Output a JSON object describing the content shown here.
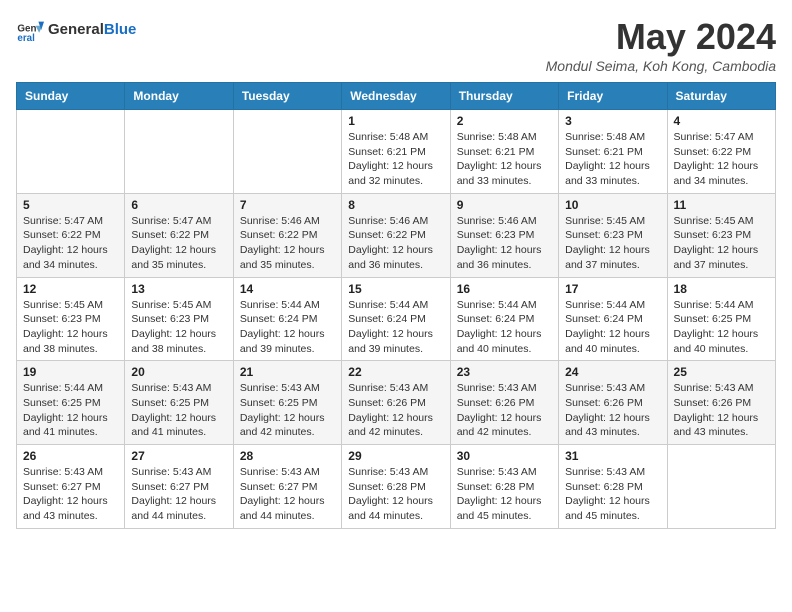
{
  "header": {
    "logo_line1": "General",
    "logo_line2": "Blue",
    "title": "May 2024",
    "subtitle": "Mondul Seima, Koh Kong, Cambodia"
  },
  "days_of_week": [
    "Sunday",
    "Monday",
    "Tuesday",
    "Wednesday",
    "Thursday",
    "Friday",
    "Saturday"
  ],
  "weeks": [
    [
      {
        "day": "",
        "details": ""
      },
      {
        "day": "",
        "details": ""
      },
      {
        "day": "",
        "details": ""
      },
      {
        "day": "1",
        "details": "Sunrise: 5:48 AM\nSunset: 6:21 PM\nDaylight: 12 hours\nand 32 minutes."
      },
      {
        "day": "2",
        "details": "Sunrise: 5:48 AM\nSunset: 6:21 PM\nDaylight: 12 hours\nand 33 minutes."
      },
      {
        "day": "3",
        "details": "Sunrise: 5:48 AM\nSunset: 6:21 PM\nDaylight: 12 hours\nand 33 minutes."
      },
      {
        "day": "4",
        "details": "Sunrise: 5:47 AM\nSunset: 6:22 PM\nDaylight: 12 hours\nand 34 minutes."
      }
    ],
    [
      {
        "day": "5",
        "details": "Sunrise: 5:47 AM\nSunset: 6:22 PM\nDaylight: 12 hours\nand 34 minutes."
      },
      {
        "day": "6",
        "details": "Sunrise: 5:47 AM\nSunset: 6:22 PM\nDaylight: 12 hours\nand 35 minutes."
      },
      {
        "day": "7",
        "details": "Sunrise: 5:46 AM\nSunset: 6:22 PM\nDaylight: 12 hours\nand 35 minutes."
      },
      {
        "day": "8",
        "details": "Sunrise: 5:46 AM\nSunset: 6:22 PM\nDaylight: 12 hours\nand 36 minutes."
      },
      {
        "day": "9",
        "details": "Sunrise: 5:46 AM\nSunset: 6:23 PM\nDaylight: 12 hours\nand 36 minutes."
      },
      {
        "day": "10",
        "details": "Sunrise: 5:45 AM\nSunset: 6:23 PM\nDaylight: 12 hours\nand 37 minutes."
      },
      {
        "day": "11",
        "details": "Sunrise: 5:45 AM\nSunset: 6:23 PM\nDaylight: 12 hours\nand 37 minutes."
      }
    ],
    [
      {
        "day": "12",
        "details": "Sunrise: 5:45 AM\nSunset: 6:23 PM\nDaylight: 12 hours\nand 38 minutes."
      },
      {
        "day": "13",
        "details": "Sunrise: 5:45 AM\nSunset: 6:23 PM\nDaylight: 12 hours\nand 38 minutes."
      },
      {
        "day": "14",
        "details": "Sunrise: 5:44 AM\nSunset: 6:24 PM\nDaylight: 12 hours\nand 39 minutes."
      },
      {
        "day": "15",
        "details": "Sunrise: 5:44 AM\nSunset: 6:24 PM\nDaylight: 12 hours\nand 39 minutes."
      },
      {
        "day": "16",
        "details": "Sunrise: 5:44 AM\nSunset: 6:24 PM\nDaylight: 12 hours\nand 40 minutes."
      },
      {
        "day": "17",
        "details": "Sunrise: 5:44 AM\nSunset: 6:24 PM\nDaylight: 12 hours\nand 40 minutes."
      },
      {
        "day": "18",
        "details": "Sunrise: 5:44 AM\nSunset: 6:25 PM\nDaylight: 12 hours\nand 40 minutes."
      }
    ],
    [
      {
        "day": "19",
        "details": "Sunrise: 5:44 AM\nSunset: 6:25 PM\nDaylight: 12 hours\nand 41 minutes."
      },
      {
        "day": "20",
        "details": "Sunrise: 5:43 AM\nSunset: 6:25 PM\nDaylight: 12 hours\nand 41 minutes."
      },
      {
        "day": "21",
        "details": "Sunrise: 5:43 AM\nSunset: 6:25 PM\nDaylight: 12 hours\nand 42 minutes."
      },
      {
        "day": "22",
        "details": "Sunrise: 5:43 AM\nSunset: 6:26 PM\nDaylight: 12 hours\nand 42 minutes."
      },
      {
        "day": "23",
        "details": "Sunrise: 5:43 AM\nSunset: 6:26 PM\nDaylight: 12 hours\nand 42 minutes."
      },
      {
        "day": "24",
        "details": "Sunrise: 5:43 AM\nSunset: 6:26 PM\nDaylight: 12 hours\nand 43 minutes."
      },
      {
        "day": "25",
        "details": "Sunrise: 5:43 AM\nSunset: 6:26 PM\nDaylight: 12 hours\nand 43 minutes."
      }
    ],
    [
      {
        "day": "26",
        "details": "Sunrise: 5:43 AM\nSunset: 6:27 PM\nDaylight: 12 hours\nand 43 minutes."
      },
      {
        "day": "27",
        "details": "Sunrise: 5:43 AM\nSunset: 6:27 PM\nDaylight: 12 hours\nand 44 minutes."
      },
      {
        "day": "28",
        "details": "Sunrise: 5:43 AM\nSunset: 6:27 PM\nDaylight: 12 hours\nand 44 minutes."
      },
      {
        "day": "29",
        "details": "Sunrise: 5:43 AM\nSunset: 6:28 PM\nDaylight: 12 hours\nand 44 minutes."
      },
      {
        "day": "30",
        "details": "Sunrise: 5:43 AM\nSunset: 6:28 PM\nDaylight: 12 hours\nand 45 minutes."
      },
      {
        "day": "31",
        "details": "Sunrise: 5:43 AM\nSunset: 6:28 PM\nDaylight: 12 hours\nand 45 minutes."
      },
      {
        "day": "",
        "details": ""
      }
    ]
  ]
}
